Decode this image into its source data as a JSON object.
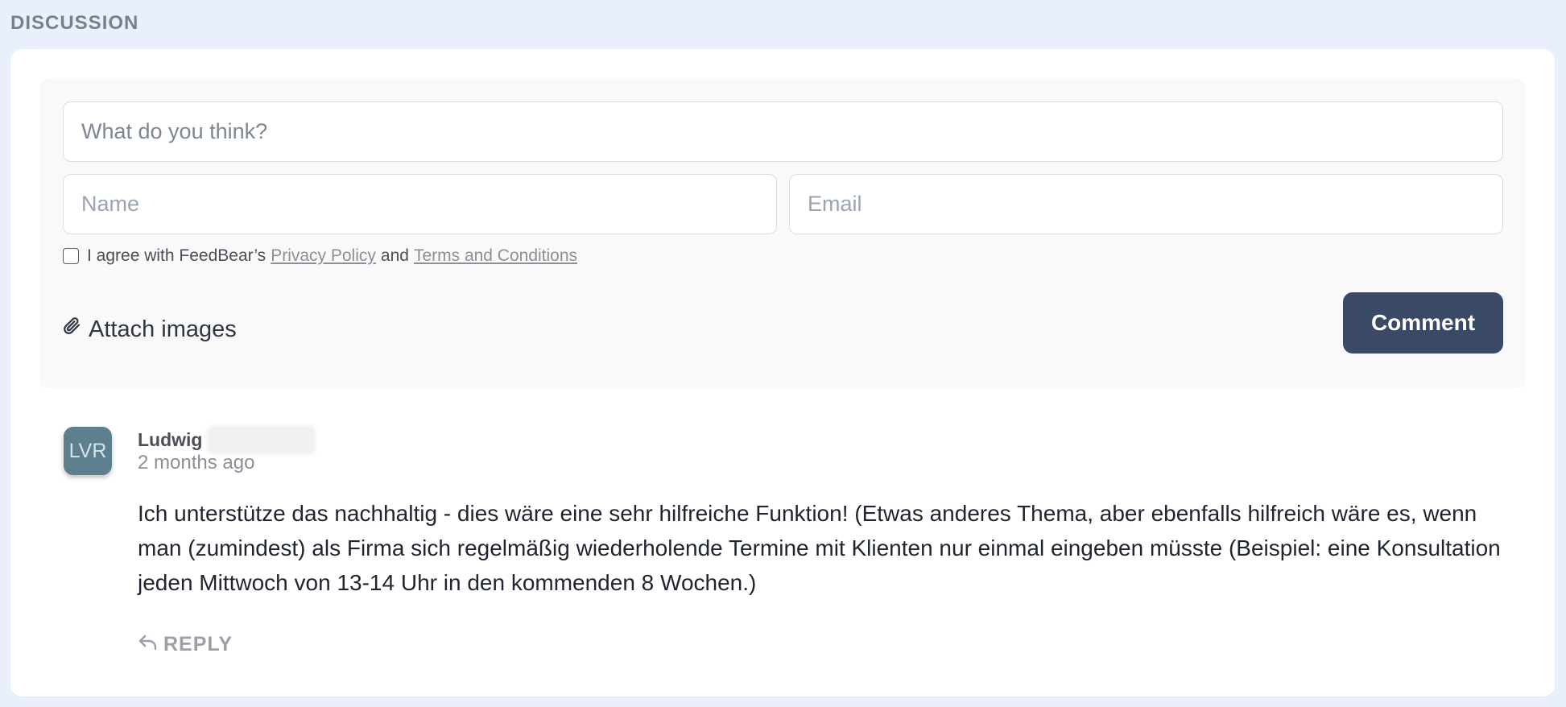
{
  "section": {
    "title": "DISCUSSION"
  },
  "composer": {
    "comment_placeholder": "What do you think?",
    "name_placeholder": "Name",
    "email_placeholder": "Email",
    "agree_prefix": "I agree with FeedBear’s",
    "privacy_link": "Privacy Policy",
    "agree_and": "and",
    "terms_link": "Terms and Conditions",
    "attach_label": "Attach images",
    "submit_label": "Comment",
    "colors": {
      "button_bg": "#3a4a66",
      "panel_bg": "#f9f9f9"
    }
  },
  "comments": [
    {
      "avatar_initials": "LVR",
      "author_first_name": "Ludwig",
      "time_ago": "2 months ago",
      "body": "Ich unterstütze das nachhaltig - dies wäre eine sehr hilfreiche Funktion! (Etwas anderes Thema, aber ebenfalls hilfreich wäre es, wenn man (zumindest) als Firma sich regelmäßig wiederholende Termine mit Klienten nur einmal eingeben müsste (Beispiel: eine Konsultation jeden Mittwoch von 13-14 Uhr in den kommenden 8 Wochen.)",
      "reply_label": "REPLY",
      "avatar_color": "#5e7f8e"
    }
  ]
}
